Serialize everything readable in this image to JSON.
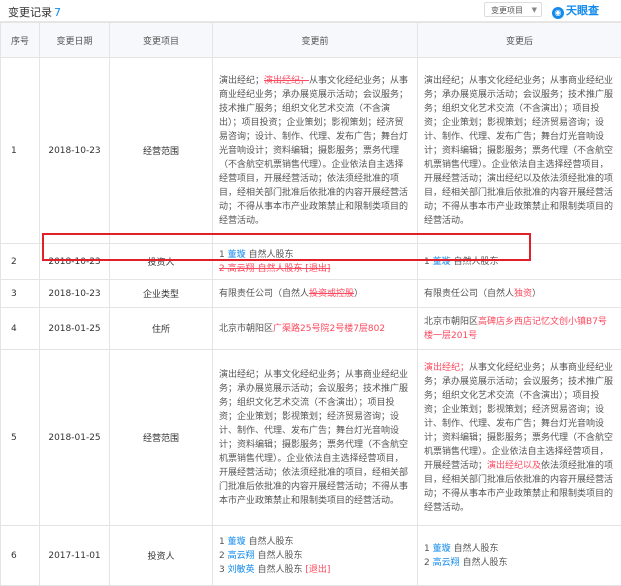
{
  "header": {
    "title": "变更记录",
    "count": "7",
    "filter_label": "变更项目",
    "logo_text": "天眼查"
  },
  "columns": [
    "序号",
    "变更日期",
    "变更项目",
    "变更前",
    "变更后"
  ],
  "rows": [
    {
      "num": "1",
      "date": "2018-10-23",
      "item": "经营范围",
      "before": [
        {
          "t": "演出经纪；"
        },
        {
          "t": "演出经纪；",
          "s": "rm"
        },
        {
          "t": "从事文化经纪业务；从事商业经纪业务；承办展览展示活动；会议服务；技术推广服务；组织文化艺术交流（不含演出）；项目投资；企业策划；影视策划；经济贸易咨询；设计、制作、代理、发布广告；舞台灯光音响设计；资料编辑；摄影服务；票务代理（不含航空机票销售代理）。企业依法自主选择经营项目，开展经营活动；依法须经批准的项目，经相关部门批准后依批准的内容开展经营活动；不得从事本市产业政策禁止和限制类项目的经营活动。"
        }
      ],
      "after": [
        {
          "t": "演出经纪；从事文化经纪业务；从事商业经纪业务；承办展览展示活动；会议服务；技术推广服务；组织文化艺术交流（不含演出）；项目投资；企业策划；影视策划；经济贸易咨询；设计、制作、代理、发布广告；舞台灯光音响设计；资料编辑；摄影服务；票务代理（不含航空机票销售代理）。企业依法自主选择经营项目，开展经营活动；演出经纪以及依法须经批准的项目，经相关部门批准后依批准的内容开展经营活动；不得从事本市产业政策禁止和限制类项目的经营活动。"
        }
      ]
    },
    {
      "num": "2",
      "date": "2018-10-23",
      "item": "投资人",
      "before_lines": [
        [
          {
            "t": "1 "
          },
          {
            "t": "董璇",
            "s": "person"
          },
          {
            "t": " 自然人股东"
          }
        ],
        [
          {
            "t": "2 高云翔 自然人股东 [退出]",
            "s": "rmp"
          }
        ]
      ],
      "after_lines": [
        [
          {
            "t": "1 "
          },
          {
            "t": "董璇",
            "s": "person"
          },
          {
            "t": " 自然人股东"
          }
        ]
      ]
    },
    {
      "num": "3",
      "date": "2018-10-23",
      "item": "企业类型",
      "before": [
        {
          "t": "有限责任公司（自然人"
        },
        {
          "t": "投资或控股",
          "s": "rm"
        },
        {
          "t": "）"
        }
      ],
      "after": [
        {
          "t": "有限责任公司（自然人"
        },
        {
          "t": "独资",
          "s": "add"
        },
        {
          "t": "）"
        }
      ]
    },
    {
      "num": "4",
      "date": "2018-01-25",
      "item": "住所",
      "before": [
        {
          "t": "北京市朝阳区"
        },
        {
          "t": "广渠路25号院2号楼7层802",
          "s": "add"
        }
      ],
      "after": [
        {
          "t": "北京市朝阳区"
        },
        {
          "t": "高碑店乡西店记忆文创小镇B7号楼一层201号",
          "s": "add"
        }
      ]
    },
    {
      "num": "5",
      "date": "2018-01-25",
      "item": "经营范围",
      "before": [
        {
          "t": "演出经纪；从事文化经纪业务；从事商业经纪业务；承办展览展示活动；会议服务；技术推广服务；组织文化艺术交流（不含演出）；项目投资；企业策划；影视策划；经济贸易咨询；设计、制作、代理、发布广告；舞台灯光音响设计；资料编辑；摄影服务；票务代理（不含航空机票销售代理）。企业依法自主选择经营项目，开展经营活动；依法须经批准的项目，经相关部门批准后依批准的内容开展经营活动；不得从事本市产业政策禁止和限制类项目的经营活动。"
        }
      ],
      "after": [
        {
          "t": "演出经纪；",
          "s": "add"
        },
        {
          "t": "从事文化经纪业务；从事商业经纪业务；承办展览展示活动；会议服务；技术推广服务；组织文化艺术交流（不含演出）；项目投资；企业策划；影视策划；经济贸易咨询；设计、制作、代理、发布广告；舞台灯光音响设计；资料编辑；摄影服务；票务代理（不含航空机票销售代理）。企业依法自主选择经营项目，开展经营活动；"
        },
        {
          "t": "演出经纪以及",
          "s": "add"
        },
        {
          "t": "依法须经批准的项目，经相关部门批准后依批准的内容开展经营活动；不得从事本市产业政策禁止和限制类项目的经营活动。"
        }
      ]
    },
    {
      "num": "6",
      "date": "2017-11-01",
      "item": "投资人",
      "before_lines": [
        [
          {
            "t": "1 "
          },
          {
            "t": "董璇",
            "s": "person"
          },
          {
            "t": " 自然人股东"
          }
        ],
        [
          {
            "t": "2 "
          },
          {
            "t": "高云翔",
            "s": "person"
          },
          {
            "t": " 自然人股东"
          }
        ],
        [
          {
            "t": "3 "
          },
          {
            "t": "刘敏英",
            "s": "person"
          },
          {
            "t": " 自然人股东 "
          },
          {
            "t": "[退出]",
            "s": "exit"
          }
        ]
      ],
      "after_lines": [
        [
          {
            "t": "1 "
          },
          {
            "t": "董璇",
            "s": "person"
          },
          {
            "t": " 自然人股东"
          }
        ],
        [
          {
            "t": "2 "
          },
          {
            "t": "高云翔",
            "s": "person"
          },
          {
            "t": " 自然人股东"
          }
        ]
      ]
    }
  ],
  "colors": {
    "accent": "#128bed",
    "changed": "#fd485e",
    "highlight": "#e0202a"
  }
}
